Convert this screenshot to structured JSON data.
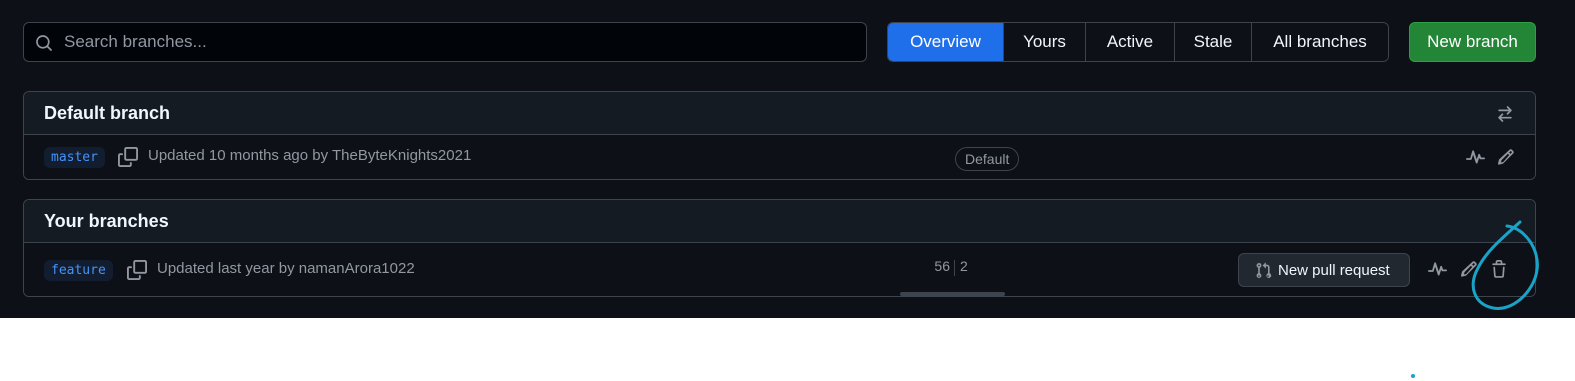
{
  "search": {
    "placeholder": "Search branches..."
  },
  "tabs": [
    {
      "label": "Overview",
      "selected": true
    },
    {
      "label": "Yours",
      "selected": false
    },
    {
      "label": "Active",
      "selected": false
    },
    {
      "label": "Stale",
      "selected": false
    },
    {
      "label": "All branches",
      "selected": false
    }
  ],
  "new_branch_label": "New branch",
  "default_section": {
    "title": "Default branch",
    "header_icon": "arrow-switch-icon",
    "branch": {
      "name": "master",
      "updated": "Updated 10 months ago by TheByteKnights2021",
      "badge": "Default",
      "icons": [
        "copy-icon",
        "pulse-icon",
        "pencil-icon"
      ]
    }
  },
  "your_section": {
    "title": "Your branches",
    "branch": {
      "name": "feature",
      "updated": "Updated last year by namanArora1022",
      "behind": "56",
      "ahead": "2",
      "pull_request_label": "New pull request",
      "icons": [
        "copy-icon",
        "git-pull-request-icon",
        "pulse-icon",
        "pencil-icon",
        "trash-icon"
      ]
    }
  },
  "colors": {
    "background": "#0d1117",
    "accent": "#1f6feb",
    "primary_button": "#238636",
    "annotation": "#1aa3c9"
  }
}
